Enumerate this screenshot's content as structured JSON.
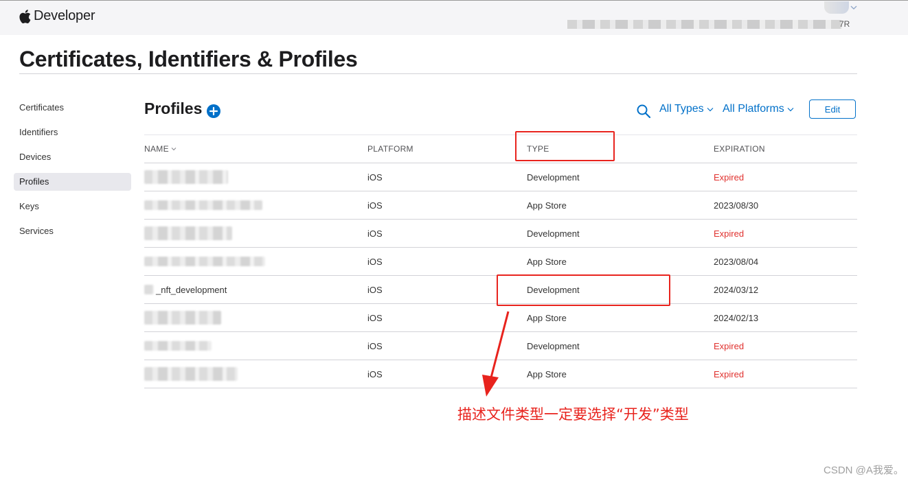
{
  "header": {
    "brand": "Developer",
    "account_suffix": "7R"
  },
  "page_title": "Certificates, Identifiers & Profiles",
  "sidebar": {
    "items": [
      {
        "label": "Certificates",
        "active": false
      },
      {
        "label": "Identifiers",
        "active": false
      },
      {
        "label": "Devices",
        "active": false
      },
      {
        "label": "Profiles",
        "active": true
      },
      {
        "label": "Keys",
        "active": false
      },
      {
        "label": "Services",
        "active": false
      }
    ]
  },
  "main": {
    "section_title": "Profiles",
    "filters": {
      "type": "All Types",
      "platform": "All Platforms"
    },
    "edit_label": "Edit",
    "columns": [
      "NAME",
      "PLATFORM",
      "TYPE",
      "EXPIRATION"
    ],
    "rows": [
      {
        "name": "",
        "platform": "iOS",
        "type": "Development",
        "expiration": "Expired",
        "expired": true
      },
      {
        "name": "",
        "platform": "iOS",
        "type": "App Store",
        "expiration": "2023/08/30",
        "expired": false
      },
      {
        "name": "",
        "platform": "iOS",
        "type": "Development",
        "expiration": "Expired",
        "expired": true
      },
      {
        "name": "",
        "platform": "iOS",
        "type": "App Store",
        "expiration": "2023/08/04",
        "expired": false
      },
      {
        "name": "_nft_development",
        "platform": "iOS",
        "type": "Development",
        "expiration": "2024/03/12",
        "expired": false
      },
      {
        "name": "",
        "platform": "iOS",
        "type": "App Store",
        "expiration": "2024/02/13",
        "expired": false
      },
      {
        "name": "",
        "platform": "iOS",
        "type": "Development",
        "expiration": "Expired",
        "expired": true
      },
      {
        "name": "",
        "platform": "iOS",
        "type": "App Store",
        "expiration": "Expired",
        "expired": true
      }
    ]
  },
  "annotation": "描述文件类型一定要选择“开发”类型",
  "watermark": "CSDN @A我爱。",
  "colors": {
    "accent": "#0070c9",
    "expired": "#e0302d",
    "annotation": "#e8231d"
  }
}
